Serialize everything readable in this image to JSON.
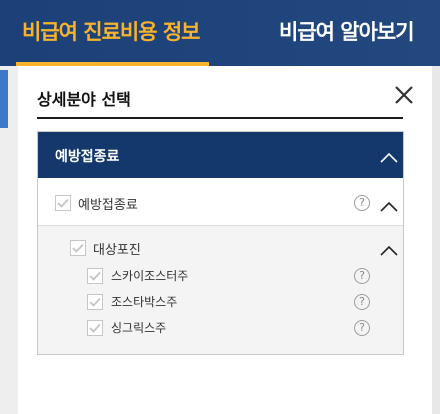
{
  "tabs": {
    "active_label": "비급여 진료비용 정보",
    "other_label": "비급여 알아보기"
  },
  "modal": {
    "title": "상세분야 선택",
    "close_icon": "close-icon",
    "panel": {
      "header_label": "예방접종료",
      "category": {
        "label": "예방접종료",
        "checked": true,
        "help": "?"
      },
      "subcategory": {
        "label": "대상포진",
        "checked": true,
        "items": [
          {
            "label": "스카이조스터주",
            "checked": true,
            "help": "?"
          },
          {
            "label": "조스타박스주",
            "checked": true,
            "help": "?"
          },
          {
            "label": "싱그릭스주",
            "checked": true,
            "help": "?"
          }
        ]
      }
    }
  },
  "colors": {
    "topbar": "#1c4077",
    "accent": "#f7b32b",
    "panel_header": "#14386c"
  }
}
